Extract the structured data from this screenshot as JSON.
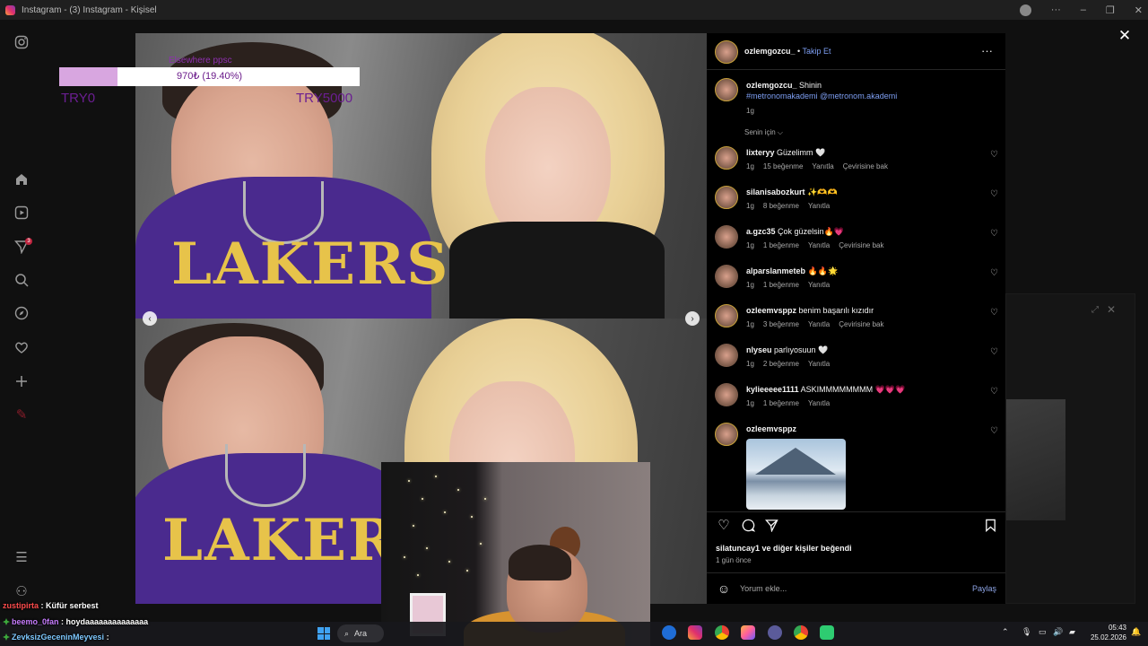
{
  "browser": {
    "title": "Instagram - (3) Instagram - Kişisel"
  },
  "nav": {
    "messages_badge": "3"
  },
  "donation": {
    "title": "Elsewhere ppsc",
    "amount_text": "970₺ (19.40%)",
    "progress_fraction": 0.194,
    "min_label": "TRY0",
    "max_label": "TRY5000"
  },
  "post": {
    "author": "ozlemgozcu_",
    "follow_separator": "•",
    "follow_label": "Takip Et",
    "caption_user": "ozlemgozcu_",
    "caption_text": "Shinin",
    "caption_tags": "#metronomakademi @metronom.akademi",
    "caption_time": "1g",
    "sort_label": "Senin için",
    "likes_text": "silatuncay1 ve diğer kişiler beğendi",
    "time_ago": "1 gün önce",
    "comment_placeholder": "Yorum ekle...",
    "share_label": "Paylaş"
  },
  "comments": [
    {
      "user": "lixteryy",
      "text": "Güzelimm 🤍",
      "time": "1g",
      "likes": "15 beğenme",
      "reply": "Yanıtla",
      "translate": "Çevirisine bak"
    },
    {
      "user": "silanisabozkurt",
      "text": "✨🫶🫶",
      "time": "1g",
      "likes": "8 beğenme",
      "reply": "Yanıtla",
      "translate": ""
    },
    {
      "user": "a.gzc35",
      "text": "Çok güzelsin🔥💗",
      "time": "1g",
      "likes": "1 beğenme",
      "reply": "Yanıtla",
      "translate": "Çevirisine bak"
    },
    {
      "user": "alparslanmeteb",
      "text": "🔥🔥🌟",
      "time": "1g",
      "likes": "1 beğenme",
      "reply": "Yanıtla",
      "translate": ""
    },
    {
      "user": "ozleemvsppz",
      "text": "benim başarılı kızıdır",
      "time": "1g",
      "likes": "3 beğenme",
      "reply": "Yanıtla",
      "translate": "Çevirisine bak"
    },
    {
      "user": "nlyseu",
      "text": "parlıyosuun 🤍",
      "time": "1g",
      "likes": "2 beğenme",
      "reply": "Yanıtla",
      "translate": ""
    },
    {
      "user": "kylieeeee1111",
      "text": "ASKIMMMMMMMM 💗💗💗",
      "time": "1g",
      "likes": "1 beğenme",
      "reply": "Yanıtla",
      "translate": ""
    },
    {
      "user": "ozleemvsppz",
      "text": "",
      "time": "",
      "likes": "",
      "reply": "",
      "translate": ""
    }
  ],
  "photo": {
    "shirt_text": "LAKERS"
  },
  "chat": [
    {
      "user": "zustipirta",
      "message": "Küfür serbest",
      "color": "#ff4d4d",
      "badge": false
    },
    {
      "user": "beemo_0fan",
      "message": "hoydaaaaaaaaaaaaaa",
      "color": "#c77dff",
      "badge": true
    },
    {
      "user": "ZevksizGeceninMeyvesi",
      "message": "",
      "color": "#7ec8ff",
      "badge": true
    }
  ],
  "taskbar": {
    "search_label": "Ara",
    "time": "05:43",
    "date": "25.02.2026"
  },
  "colors": {
    "accent_link": "#7e9ff3",
    "donation_fill": "#d8a6e0",
    "donation_text": "#6a1a8a"
  }
}
